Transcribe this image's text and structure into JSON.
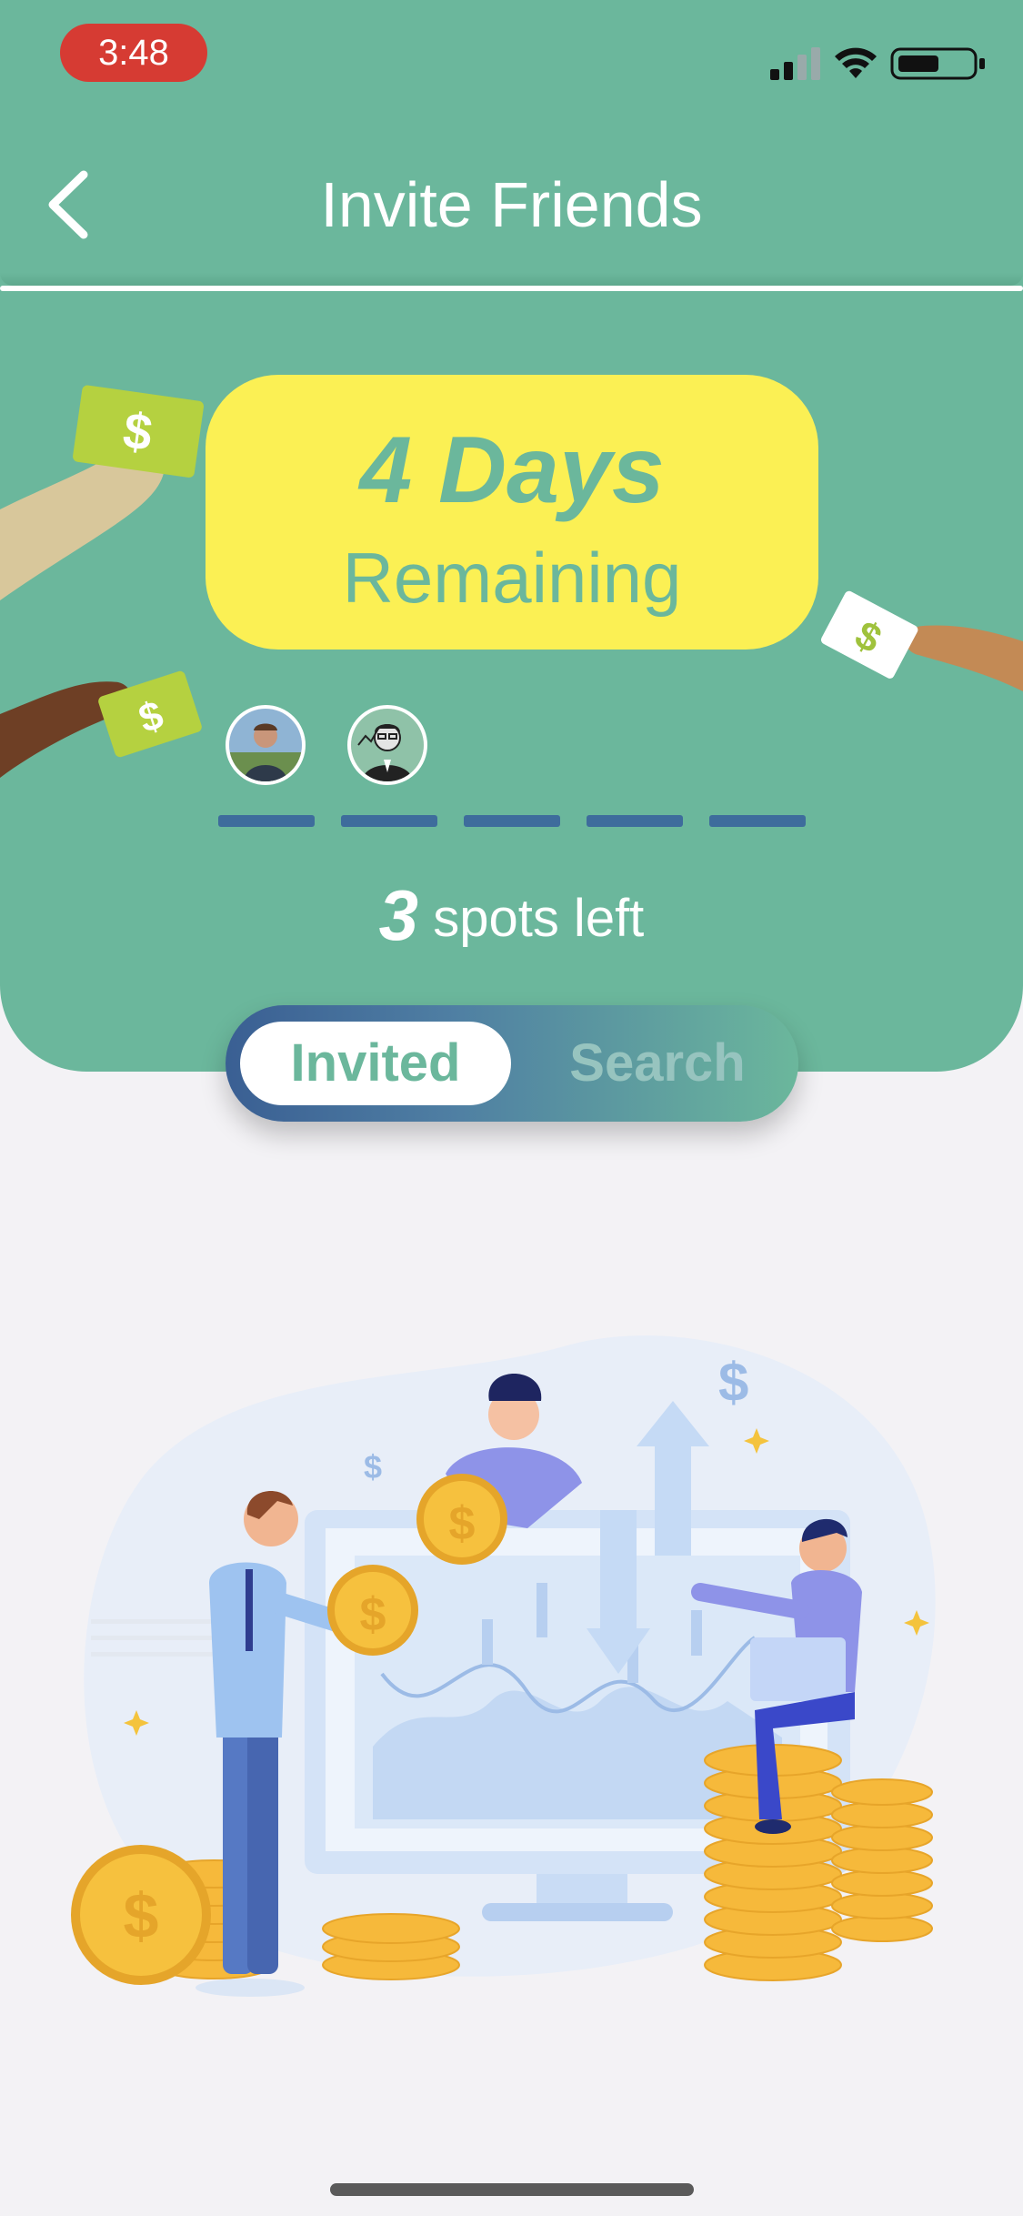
{
  "status_bar": {
    "time": "3:48"
  },
  "header": {
    "title": "Invite Friends"
  },
  "countdown": {
    "days": "4 Days",
    "label": "Remaining"
  },
  "spots": {
    "number": "3",
    "text": "spots left"
  },
  "tabs": {
    "invited": "Invited",
    "search": "Search"
  },
  "illustration": {
    "currency_symbol": "$"
  },
  "colors": {
    "primary": "#6bb79c",
    "accent": "#fbf054",
    "dash": "#3e6c9c"
  }
}
